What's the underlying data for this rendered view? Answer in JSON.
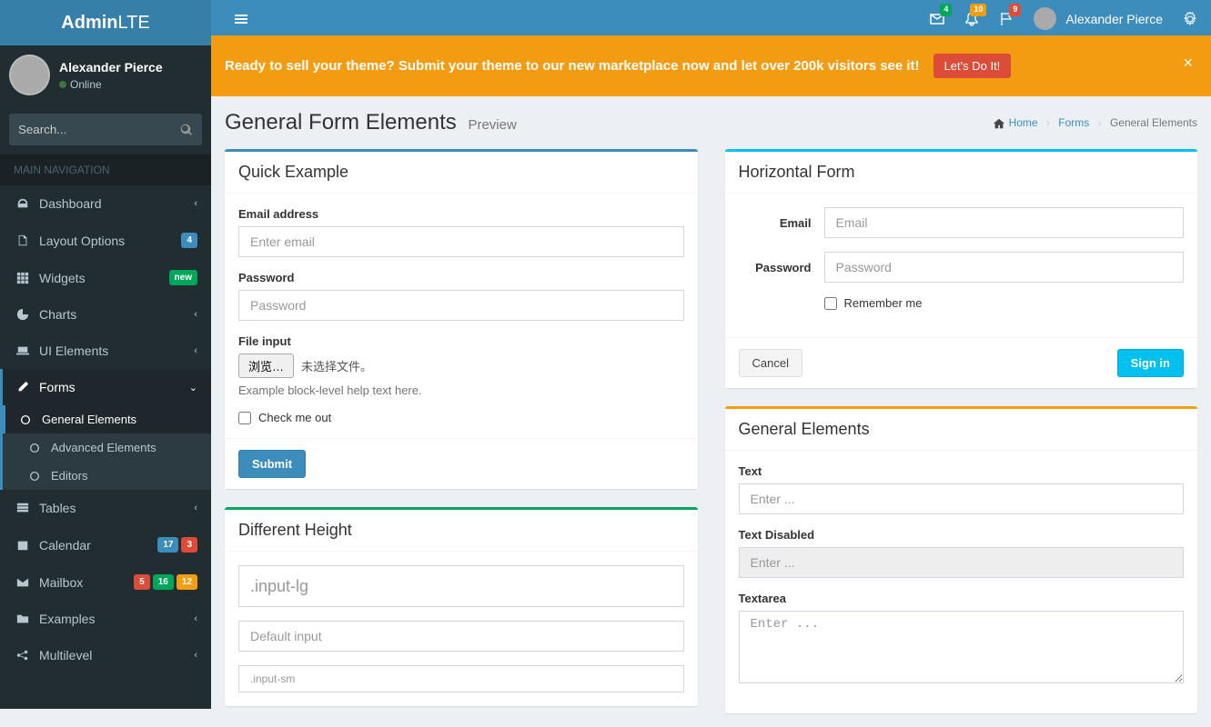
{
  "logo": {
    "bold": "Admin",
    "light": "LTE"
  },
  "user": {
    "name": "Alexander Pierce",
    "status": "Online"
  },
  "sidebar_search": {
    "placeholder": "Search..."
  },
  "sidebar_header": "MAIN NAVIGATION",
  "nav": {
    "dashboard": "Dashboard",
    "layout": "Layout Options",
    "layout_badge": "4",
    "widgets": "Widgets",
    "widgets_badge": "new",
    "charts": "Charts",
    "ui": "UI Elements",
    "forms": "Forms",
    "forms_general": "General Elements",
    "forms_advanced": "Advanced Elements",
    "forms_editors": "Editors",
    "tables": "Tables",
    "calendar": "Calendar",
    "calendar_b1": "17",
    "calendar_b2": "3",
    "mailbox": "Mailbox",
    "mailbox_b1": "5",
    "mailbox_b2": "16",
    "mailbox_b3": "12",
    "examples": "Examples",
    "multilevel": "Multilevel"
  },
  "topnav": {
    "messages_count": "4",
    "notifications_count": "10",
    "tasks_count": "9",
    "username": "Alexander Pierce"
  },
  "alert": {
    "text": "Ready to sell your theme? Submit your theme to our new marketplace now and let over 200k visitors see it!",
    "button": "Let's Do It!"
  },
  "page": {
    "title": "General Form Elements",
    "subtitle": "Preview"
  },
  "breadcrumb": {
    "home": "Home",
    "forms": "Forms",
    "current": "General Elements"
  },
  "box_quick": {
    "title": "Quick Example",
    "email_label": "Email address",
    "email_placeholder": "Enter email",
    "password_label": "Password",
    "password_placeholder": "Password",
    "file_label": "File input",
    "file_browse": "浏览…",
    "file_none": "未选择文件。",
    "file_help": "Example block-level help text here.",
    "check_label": "Check me out",
    "submit": "Submit"
  },
  "box_height": {
    "title": "Different Height",
    "lg_placeholder": ".input-lg",
    "def_placeholder": "Default input",
    "sm_placeholder": ".input-sm"
  },
  "box_horizontal": {
    "title": "Horizontal Form",
    "email_label": "Email",
    "email_placeholder": "Email",
    "password_label": "Password",
    "password_placeholder": "Password",
    "remember": "Remember me",
    "cancel": "Cancel",
    "signin": "Sign in"
  },
  "box_general": {
    "title": "General Elements",
    "text_label": "Text",
    "text_placeholder": "Enter ...",
    "disabled_label": "Text Disabled",
    "disabled_placeholder": "Enter ...",
    "textarea_label": "Textarea",
    "textarea_placeholder": "Enter ..."
  }
}
